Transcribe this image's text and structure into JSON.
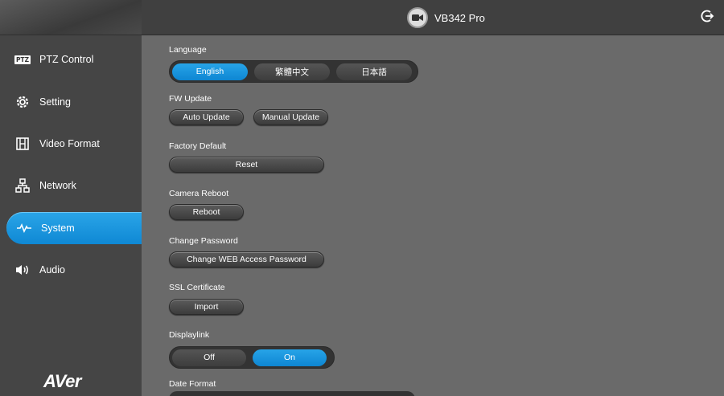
{
  "header": {
    "device_name": "VB342 Pro"
  },
  "sidebar": {
    "items": [
      {
        "label": "PTZ Control",
        "icon": "ptz-icon"
      },
      {
        "label": "Setting",
        "icon": "gear-icon"
      },
      {
        "label": "Video Format",
        "icon": "film-icon"
      },
      {
        "label": "Network",
        "icon": "network-icon"
      },
      {
        "label": "System",
        "icon": "pulse-icon",
        "active": true
      },
      {
        "label": "Audio",
        "icon": "speaker-icon"
      }
    ],
    "ptz_badge": "PTZ",
    "logo": "AVer"
  },
  "main": {
    "language": {
      "label": "Language",
      "options": [
        "English",
        "繁體中文",
        "日本語"
      ],
      "selected": "English"
    },
    "fw_update": {
      "label": "FW Update",
      "auto": "Auto Update",
      "manual": "Manual Update"
    },
    "factory_default": {
      "label": "Factory Default",
      "button": "Reset"
    },
    "camera_reboot": {
      "label": "Camera Reboot",
      "button": "Reboot"
    },
    "change_password": {
      "label": "Change Password",
      "button": "Change WEB Access Password"
    },
    "ssl_certificate": {
      "label": "SSL Certificate",
      "button": "Import"
    },
    "displaylink": {
      "label": "Displaylink",
      "options": [
        "Off",
        "On"
      ],
      "selected": "On"
    },
    "date_format": {
      "label": "Date Format"
    }
  },
  "colors": {
    "accent": "#1a93dc",
    "background": "#6a6a6a",
    "sidebar": "#454545"
  }
}
